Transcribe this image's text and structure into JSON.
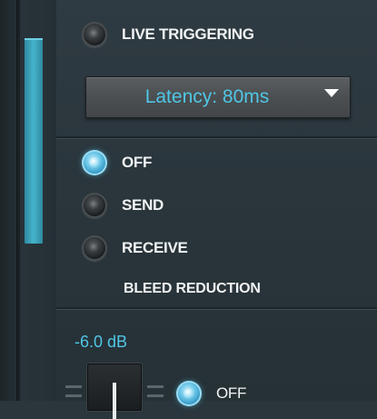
{
  "trigger": {
    "live_triggering_label": "LIVE TRIGGERING",
    "latency_value": "Latency: 80ms"
  },
  "bleed_reduction": {
    "options": [
      {
        "label": "OFF",
        "selected": true
      },
      {
        "label": "SEND",
        "selected": false
      },
      {
        "label": "RECEIVE",
        "selected": false
      }
    ],
    "title": "BLEED REDUCTION"
  },
  "fader": {
    "value_label": "-6.0 dB",
    "toggle_label": "OFF"
  },
  "colors": {
    "accent": "#4fc6e6",
    "panel_bg": "#2a363c",
    "scroll_thumb": "#45b3cb"
  }
}
